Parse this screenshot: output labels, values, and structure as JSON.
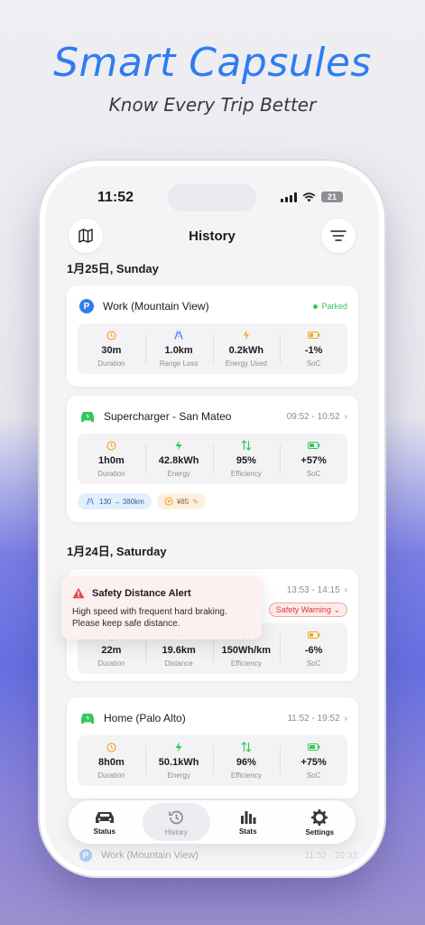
{
  "promo": {
    "headline": "Smart Capsules",
    "subheadline": "Know Every Trip Better"
  },
  "status_bar": {
    "time": "11:52",
    "battery": "21"
  },
  "header": {
    "title": "History",
    "left_icon": "map-icon",
    "right_icon": "filter-icon"
  },
  "days": [
    {
      "date": "1月25日, Sunday",
      "trips": [
        {
          "title": "Work (Mountain View)",
          "badge": "Parked",
          "icon": "parking-icon",
          "stats": [
            {
              "value": "30m",
              "label": "Duration",
              "icon": "clock-icon"
            },
            {
              "value": "1.0km",
              "label": "Range Loss",
              "icon": "road-icon"
            },
            {
              "value": "0.2kWh",
              "label": "Energy Used",
              "icon": "leaf-bolt-icon"
            },
            {
              "value": "-1%",
              "label": "SoC",
              "icon": "battery-icon"
            }
          ]
        },
        {
          "title": "Supercharger - San Mateo",
          "time": "09:52 - 10:52",
          "icon": "car-icon",
          "stats": [
            {
              "value": "1h0m",
              "label": "Duration",
              "icon": "clock-icon"
            },
            {
              "value": "42.8kWh",
              "label": "Energy",
              "icon": "bolt-icon"
            },
            {
              "value": "95%",
              "label": "Efficiency",
              "icon": "arrows-icon"
            },
            {
              "value": "+57%",
              "label": "SoC",
              "icon": "battery-icon"
            }
          ],
          "chips": [
            {
              "text": "130 → 380km",
              "icon": "road-icon"
            },
            {
              "text": "¥85",
              "icon": "coin-icon"
            }
          ]
        }
      ]
    },
    {
      "date": "1月24日, Saturday",
      "trips": [
        {
          "title": "",
          "time": "13:53 - 14:15",
          "badge": "Safety Warning",
          "icon": "car-icon",
          "stats": [
            {
              "value": "22m",
              "label": "Duration",
              "icon": "clock-icon"
            },
            {
              "value": "19.6km",
              "label": "Distance",
              "icon": "bolt-icon"
            },
            {
              "value": "150Wh/km",
              "label": "Efficiency",
              "icon": "arrows-icon"
            },
            {
              "value": "-6%",
              "label": "SoC",
              "icon": "battery-icon"
            }
          ]
        },
        {
          "title": "Home (Palo Alto)",
          "time": "11:52 - 19:52",
          "icon": "car-icon",
          "stats": [
            {
              "value": "8h0m",
              "label": "Duration",
              "icon": "clock-icon"
            },
            {
              "value": "50.1kWh",
              "label": "Energy",
              "icon": "bolt-icon"
            },
            {
              "value": "96%",
              "label": "Efficiency",
              "icon": "arrows-icon"
            },
            {
              "value": "+75%",
              "label": "SoC",
              "icon": "battery-icon"
            }
          ]
        },
        {
          "title": "Work (Mountain View)",
          "time": "11:52 - 20:32",
          "icon": "parking-icon"
        }
      ]
    }
  ],
  "alert": {
    "title": "Safety Distance Alert",
    "body_line1": "High speed with frequent hard braking.",
    "body_line2": "Please keep safe distance."
  },
  "tabs": [
    {
      "label": "Status",
      "icon": "car-icon"
    },
    {
      "label": "History",
      "icon": "history-icon",
      "active": true
    },
    {
      "label": "Stats",
      "icon": "bar-chart-icon"
    },
    {
      "label": "Settings",
      "icon": "gear-icon"
    }
  ],
  "colors": {
    "accent": "#2f7cf0",
    "green": "#34c759",
    "orange": "#f5a623",
    "danger": "#e5484d"
  }
}
